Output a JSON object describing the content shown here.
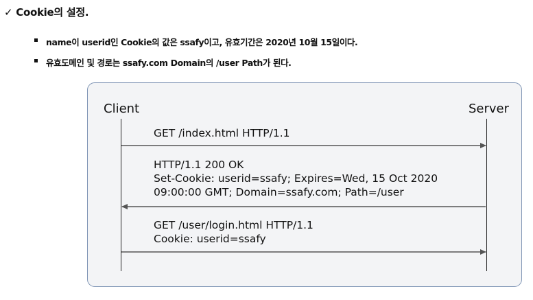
{
  "header": {
    "check_mark": "✓",
    "title": "Cookie의 설정."
  },
  "bullets": [
    "name이 userid인 Cookie의 값은 ssafy이고, 유효기간은 2020년 10월 15일이다.",
    "유효도메인 및 경로는 ssafy.com Domain의 /user Path가 된다."
  ],
  "diagram": {
    "client_label": "Client",
    "server_label": "Server",
    "messages": [
      {
        "direction": "client-to-server",
        "lines": [
          "GET /index.html HTTP/1.1"
        ]
      },
      {
        "direction": "server-to-client",
        "lines": [
          "HTTP/1.1 200 OK",
          "Set-Cookie: userid=ssafy; Expires=Wed, 15 Oct 2020",
          "09:00:00 GMT; Domain=ssafy.com; Path=/user"
        ]
      },
      {
        "direction": "client-to-server",
        "lines": [
          "GET /user/login.html HTTP/1.1",
          "Cookie: userid=ssafy"
        ]
      }
    ]
  },
  "colors": {
    "box_border": "#7f95b5",
    "box_fill": "#f3f4f6",
    "arrow": "#555555"
  }
}
